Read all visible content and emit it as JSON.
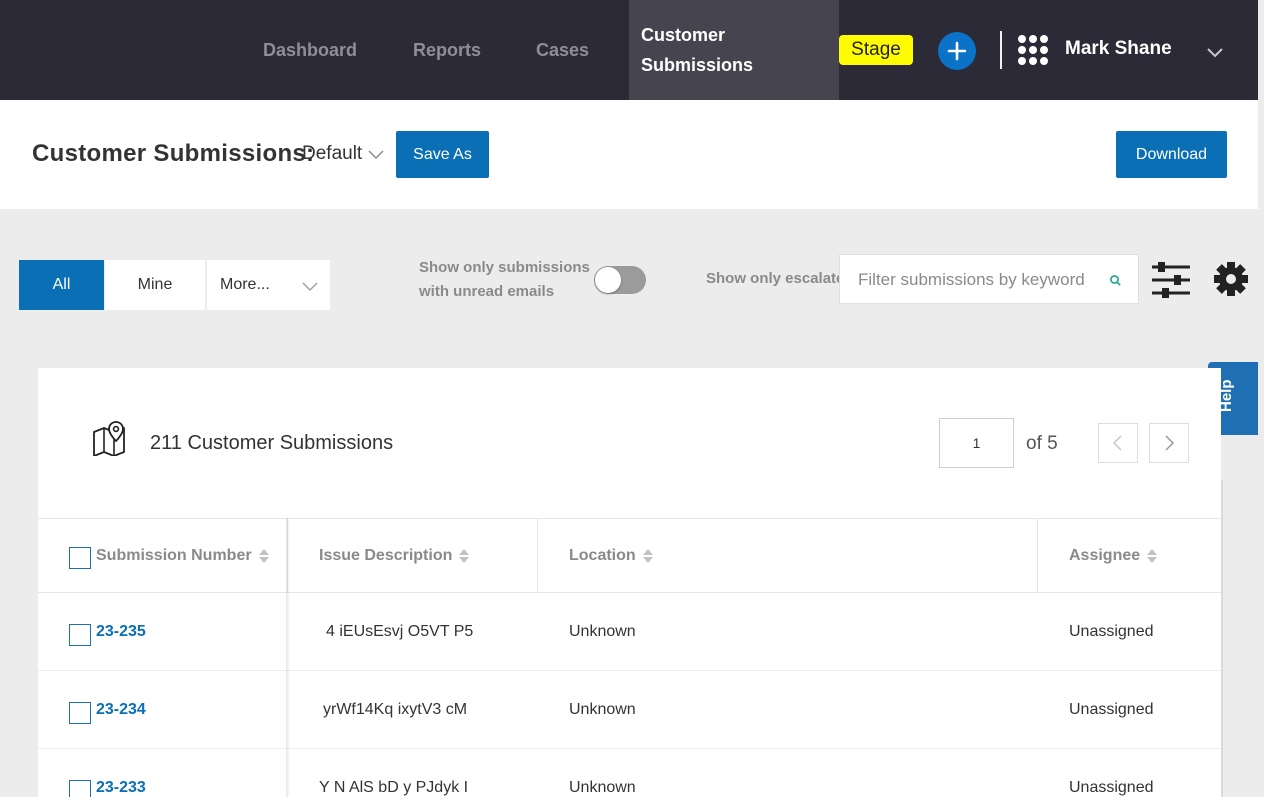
{
  "nav": {
    "items": [
      {
        "label": "Dashboard"
      },
      {
        "label": "Reports"
      },
      {
        "label": "Cases"
      },
      {
        "label": "Customer Submissions"
      }
    ],
    "stage_badge": "Stage",
    "user_name": "Mark Shane",
    "add_icon": "plus-icon",
    "apps_icon": "grid-icon"
  },
  "header": {
    "title": "Customer Submissions:",
    "view_value": "Default",
    "save_as_label": "Save As",
    "download_label": "Download"
  },
  "filters": {
    "segments": [
      "All",
      "Mine",
      "More..."
    ],
    "active_segment": "All",
    "unread_toggle_label_line1": "Show only submissions",
    "unread_toggle_label_line2": "with unread emails",
    "unread_toggle_on": false,
    "escalated_label": "Show only escalated",
    "search_placeholder": "Filter submissions by keyword"
  },
  "help_label": "Help",
  "table": {
    "count_title": "211 Customer Submissions",
    "page_value": "1",
    "page_of": "of 5",
    "columns": [
      "Submission Number",
      "Issue Description",
      "Location",
      "Assignee"
    ],
    "rows": [
      {
        "number": "23-235",
        "description": "4 iEUsEsvj O5VT P5",
        "location": "Unknown",
        "assignee": "Unassigned"
      },
      {
        "number": "23-234",
        "description": "yrWf14Kq ixytV3  cM",
        "location": "Unknown",
        "assignee": "Unassigned"
      },
      {
        "number": "23-233",
        "description": "Y N AlS bD y PJdyk I",
        "location": "Unknown",
        "assignee": "Unassigned"
      }
    ]
  },
  "colors": {
    "topbar": "#2b2a36",
    "active_nav": "#46454f",
    "primary": "#0a6fb5",
    "stage": "#fffb00"
  }
}
